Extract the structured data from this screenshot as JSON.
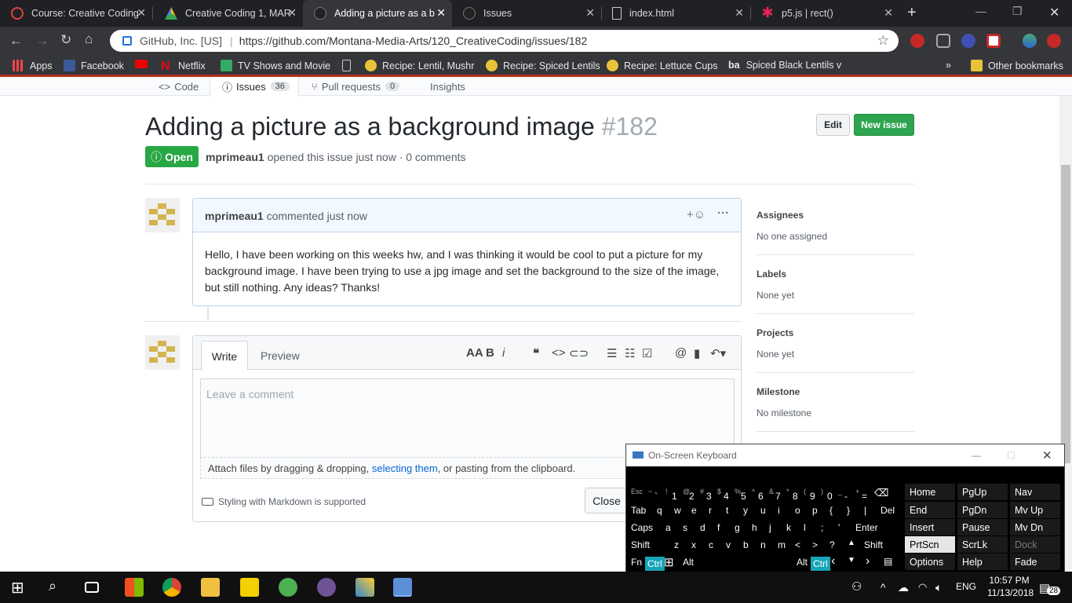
{
  "browser": {
    "tabs": [
      {
        "label": "Course: Creative Coding",
        "icon": "power-icon",
        "color": "#e04040"
      },
      {
        "label": "Creative Coding 1, MAR",
        "icon": "drive-icon",
        "color": "#fbbc04"
      },
      {
        "label": "Adding a picture as a b",
        "icon": "github-icon",
        "color": "#555"
      },
      {
        "label": "Issues",
        "icon": "github-icon",
        "color": "#555"
      },
      {
        "label": "index.html",
        "icon": "file-icon",
        "color": "#aaa"
      },
      {
        "label": "p5.js | rect()",
        "icon": "p5-star-icon",
        "color": "#ed225d"
      }
    ],
    "new_tab": "+",
    "url_org": "GitHub, Inc. [US]",
    "url": "https://github.com/Montana-Media-Arts/120_CreativeCoding/issues/182",
    "bookmarks": [
      "Apps",
      "Facebook",
      "",
      "Netflix",
      "TV Shows and Movie",
      "",
      "Recipe: Lentil, Mushr",
      "Recipe: Spiced Lentils",
      "Recipe: Lettuce Cups",
      "Spiced Black Lentils v"
    ],
    "bookmarks_more": "»",
    "other_bookmarks": "Other bookmarks",
    "ba_label": "ba"
  },
  "repo_nav": {
    "code": "Code",
    "issues": "Issues",
    "issues_count": "36",
    "pulls": "Pull requests",
    "pulls_count": "0",
    "insights": "Insights"
  },
  "issue": {
    "title": "Adding a picture as a background image",
    "number": "#182",
    "edit": "Edit",
    "new_issue": "New issue",
    "state": "Open",
    "author": "mprimeau1",
    "meta": "opened this issue just now · 0 comments"
  },
  "comment": {
    "author": "mprimeau1",
    "meta": "commented just now",
    "body": "Hello, I have been working on this weeks hw, and I was thinking it would be cool to put a picture for my background image. I have been trying to use a jpg image and set the background to the size of the image, but still nothing. Any ideas? Thanks!"
  },
  "editor": {
    "write": "Write",
    "preview": "Preview",
    "placeholder": "Leave a comment",
    "attach_pre": "Attach files by dragging & dropping, ",
    "attach_link": "selecting them",
    "attach_post": ", or pasting from the clipboard.",
    "markdown": "Styling with Markdown is supported",
    "close": "Close"
  },
  "sidebar": {
    "assignees_h": "Assignees",
    "assignees_v": "No one assigned",
    "labels_h": "Labels",
    "labels_v": "None yet",
    "projects_h": "Projects",
    "projects_v": "None yet",
    "milestone_h": "Milestone",
    "milestone_v": "No milestone"
  },
  "osk": {
    "title": "On-Screen Keyboard",
    "row1": [
      "Esc",
      "~",
      "!",
      "@",
      "#",
      "$",
      "%",
      "^",
      "&",
      "*",
      "(",
      ")",
      "_",
      "+"
    ],
    "row1b": [
      "`",
      "1",
      "2",
      "3",
      "4",
      "5",
      "6",
      "7",
      "8",
      "9",
      "0",
      "-",
      "="
    ],
    "row2": [
      "Tab",
      "q",
      "w",
      "e",
      "r",
      "t",
      "y",
      "u",
      "i",
      "o",
      "p",
      "{",
      "}",
      "|",
      "Del"
    ],
    "row3": [
      "Caps",
      "a",
      "s",
      "d",
      "f",
      "g",
      "h",
      "j",
      "k",
      "l",
      ";",
      "'",
      "Enter"
    ],
    "row4": [
      "Shift",
      "z",
      "x",
      "c",
      "v",
      "b",
      "n",
      "m",
      "<",
      ">",
      "?",
      "Shift"
    ],
    "row5": [
      "Fn",
      "Ctrl",
      "Alt",
      "Alt",
      "Ctrl"
    ],
    "nav": [
      [
        "Home",
        "PgUp",
        "Nav"
      ],
      [
        "End",
        "PgDn",
        "Mv Up"
      ],
      [
        "Insert",
        "Pause",
        "Mv Dn"
      ],
      [
        "PrtScn",
        "ScrLk",
        "Dock"
      ],
      [
        "Options",
        "Help",
        "Fade"
      ]
    ]
  },
  "taskbar": {
    "lang": "ENG",
    "time": "10:57 PM",
    "date": "11/13/2018",
    "notif": "28"
  }
}
